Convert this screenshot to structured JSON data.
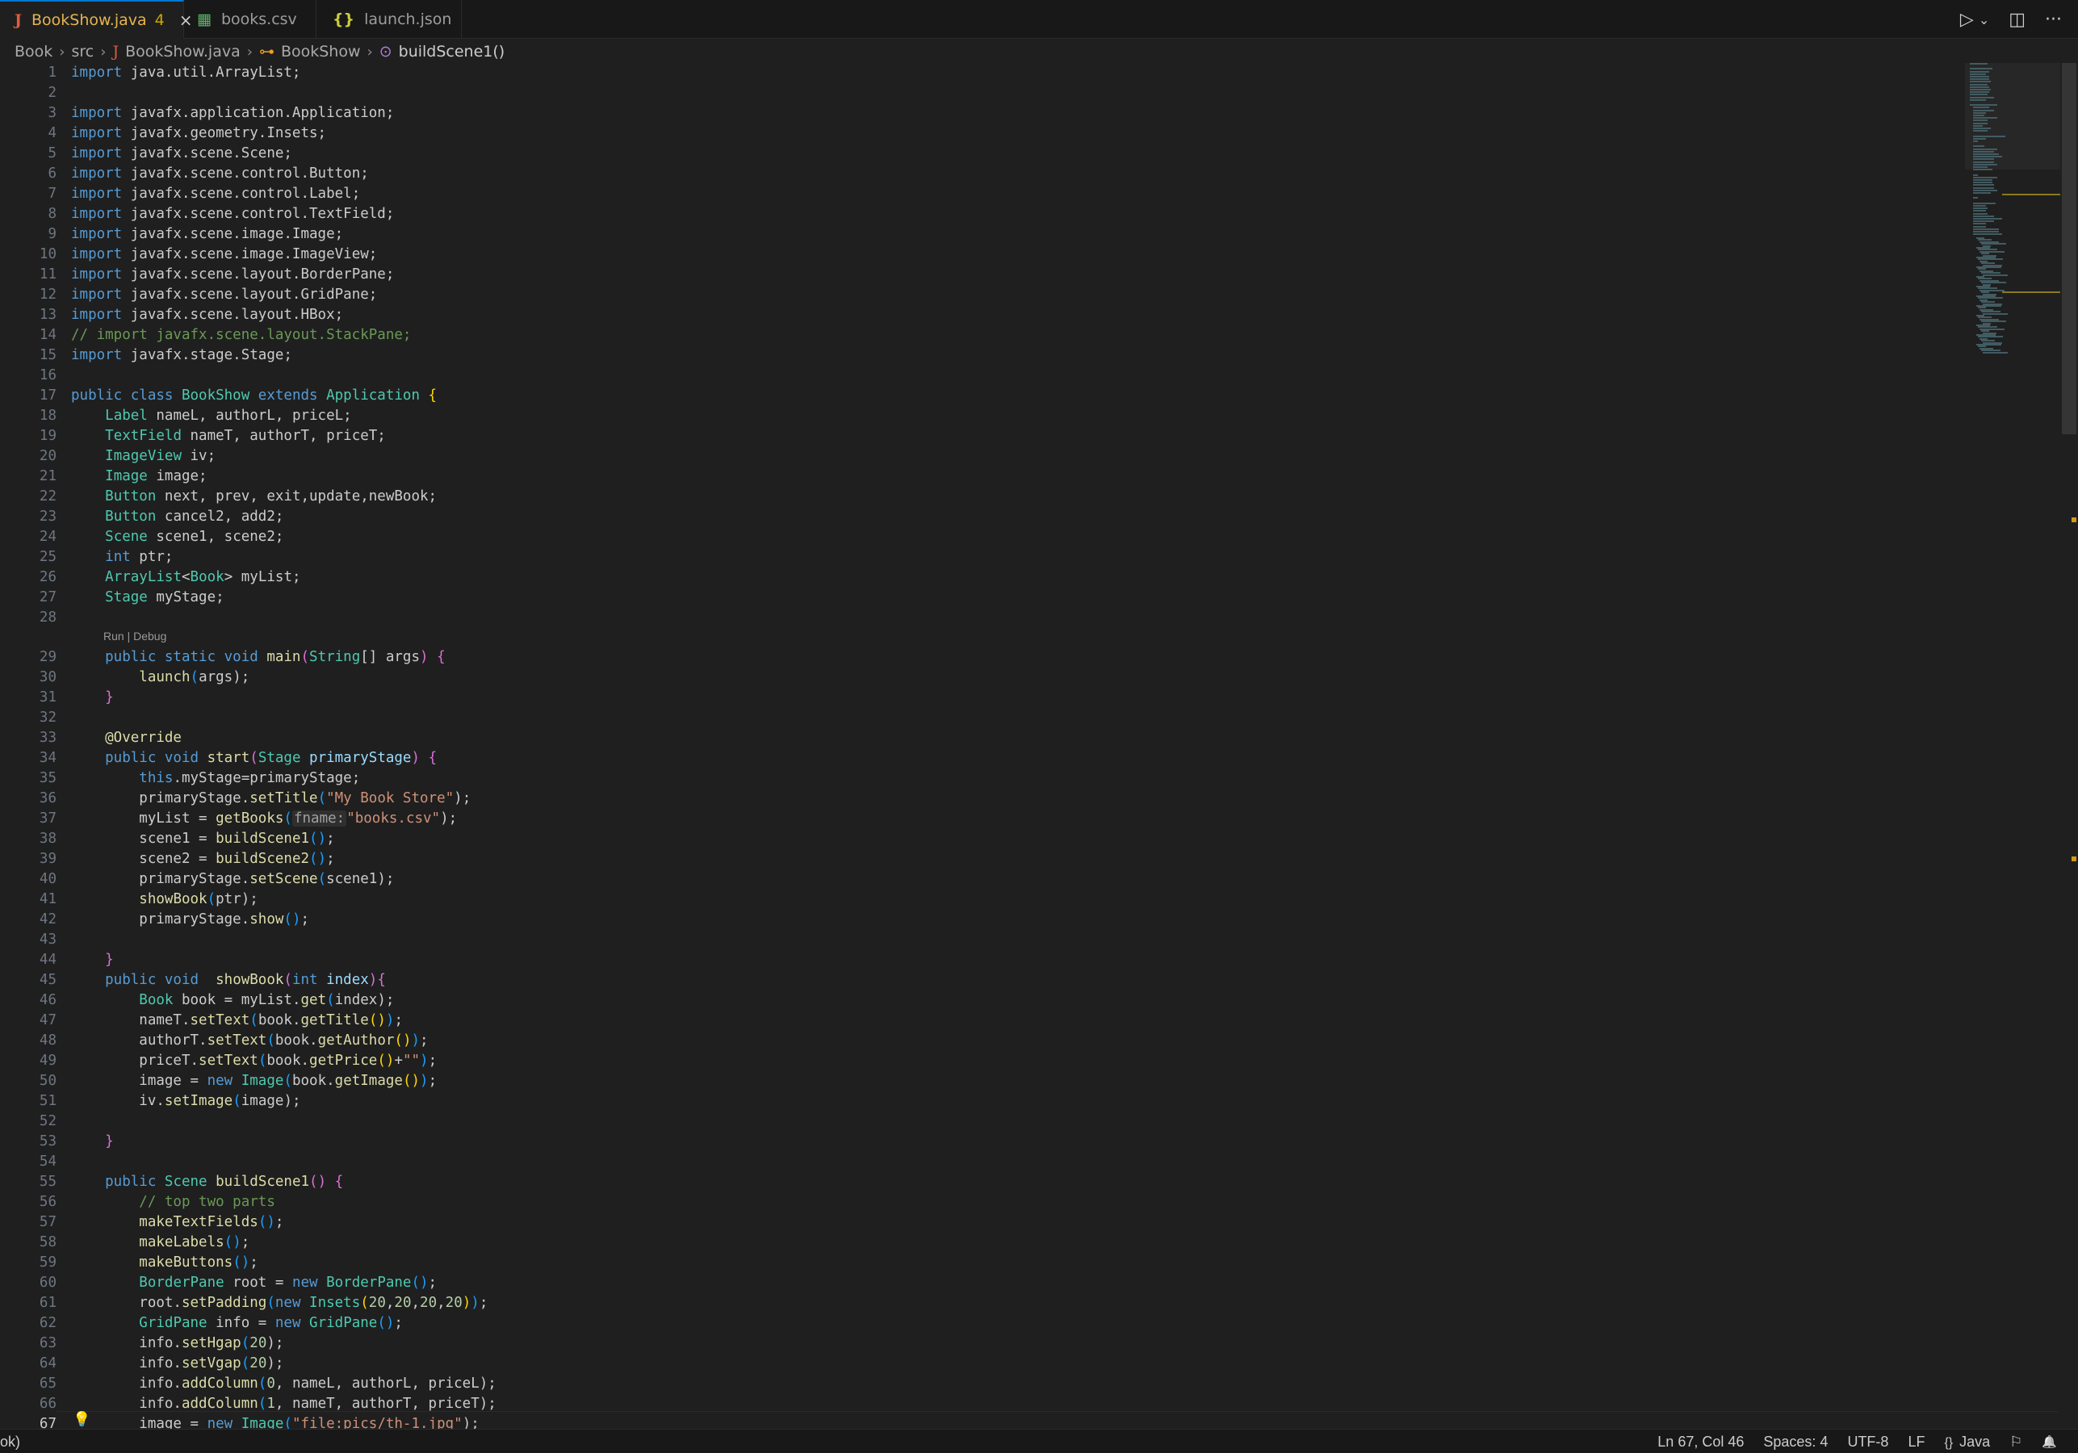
{
  "tabs": [
    {
      "icon": "J",
      "label": "BookShow.java",
      "badge": "4",
      "close": "×"
    },
    {
      "icon": "▦",
      "label": "books.csv"
    },
    {
      "icon": "{}",
      "label": "launch.json"
    }
  ],
  "actions": {
    "run": "▷",
    "run_menu": "⌄",
    "split": "◫",
    "more": "···"
  },
  "breadcrumb": {
    "project": "Book",
    "folder": "src",
    "file_icon": "J",
    "file": "BookShow.java",
    "class_icon": "⊶",
    "class": "BookShow",
    "method_icon": "⊙",
    "method": "buildScene1()"
  },
  "codelens": "Run | Debug",
  "line_numbers": [
    "1",
    "2",
    "3",
    "4",
    "5",
    "6",
    "7",
    "8",
    "9",
    "10",
    "11",
    "12",
    "13",
    "14",
    "15",
    "16",
    "17",
    "18",
    "19",
    "20",
    "21",
    "22",
    "23",
    "24",
    "25",
    "26",
    "27",
    "28",
    "29",
    "30",
    "31",
    "32",
    "33",
    "34",
    "35",
    "36",
    "37",
    "38",
    "39",
    "40",
    "41",
    "42",
    "43",
    "44",
    "45",
    "46",
    "47",
    "48",
    "49",
    "50",
    "51",
    "52",
    "53",
    "54",
    "55",
    "56",
    "57",
    "58",
    "59",
    "60",
    "61",
    "62",
    "63",
    "64",
    "65",
    "66",
    "67"
  ],
  "code": {
    "l1": [
      "import",
      " java.util.ArrayList;"
    ],
    "l3": [
      "import",
      " javafx.application.Application;"
    ],
    "l4": [
      "import",
      " javafx.geometry.Insets;"
    ],
    "l5": [
      "import",
      " javafx.scene.Scene;"
    ],
    "l6": [
      "import",
      " javafx.scene.control.Button;"
    ],
    "l7": [
      "import",
      " javafx.scene.control.Label;"
    ],
    "l8": [
      "import",
      " javafx.scene.control.TextField;"
    ],
    "l9": [
      "import",
      " javafx.scene.image.Image;"
    ],
    "l10": [
      "import",
      " javafx.scene.image.ImageView;"
    ],
    "l11": [
      "import",
      " javafx.scene.layout.BorderPane;"
    ],
    "l12": [
      "import",
      " javafx.scene.layout.GridPane;"
    ],
    "l13": [
      "import",
      " javafx.scene.layout.HBox;"
    ],
    "l14": "// import javafx.scene.layout.StackPane;",
    "l15": [
      "import",
      " javafx.stage.Stage;"
    ],
    "l17": [
      "public class ",
      "BookShow",
      " extends ",
      "Application",
      " ",
      "{"
    ],
    "l18": [
      "    ",
      "Label",
      " nameL, authorL, priceL;"
    ],
    "l19": [
      "    ",
      "TextField",
      " nameT, authorT, priceT;"
    ],
    "l20": [
      "    ",
      "ImageView",
      " iv;"
    ],
    "l21": [
      "    ",
      "Image",
      " image;"
    ],
    "l22": [
      "    ",
      "Button",
      " next, prev, exit,update,newBook;"
    ],
    "l23": [
      "    ",
      "Button",
      " cancel2, add2;"
    ],
    "l24": [
      "    ",
      "Scene",
      " scene1, scene2;"
    ],
    "l25": [
      "    ",
      "int",
      " ptr;"
    ],
    "l26": [
      "    ",
      "ArrayList",
      "<",
      "Book",
      "> myList;"
    ],
    "l27": [
      "    ",
      "Stage",
      " myStage;"
    ],
    "l29": [
      "    public static void ",
      "main",
      "(",
      "String",
      "[] args",
      ")",
      " ",
      "{"
    ],
    "l30": [
      "        ",
      "launch",
      "(",
      "args",
      ");"
    ],
    "l31": [
      "    ",
      "}"
    ],
    "l33": "    @Override",
    "l34": [
      "    public void ",
      "start",
      "(",
      "Stage",
      " primaryStage",
      ")",
      " ",
      "{"
    ],
    "l35": [
      "        this",
      ".myStage=primaryStage;"
    ],
    "l36": [
      "        primaryStage.",
      "setTitle",
      "(",
      "\"My Book Store\"",
      ");"
    ],
    "l37": [
      "        myList = ",
      "getBooks",
      "(",
      "fname:",
      "\"books.csv\"",
      ");"
    ],
    "l38": [
      "        scene1 = ",
      "buildScene1",
      "()",
      ";"
    ],
    "l39": [
      "        scene2 = ",
      "buildScene2",
      "()",
      ";"
    ],
    "l40": [
      "        primaryStage.",
      "setScene",
      "(",
      "scene1",
      ");"
    ],
    "l41": [
      "        ",
      "showBook",
      "(",
      "ptr",
      ");"
    ],
    "l42": [
      "        primaryStage.",
      "show",
      "()",
      ";"
    ],
    "l44": [
      "    ",
      "}"
    ],
    "l45": [
      "    public void  ",
      "showBook",
      "(",
      "int",
      " index",
      ")",
      "{"
    ],
    "l46": [
      "        ",
      "Book",
      " book = myList.",
      "get",
      "(",
      "index",
      ");"
    ],
    "l47": [
      "        nameT.",
      "setText",
      "(",
      "book.",
      "getTitle",
      "()",
      ")",
      ";"
    ],
    "l48": [
      "        authorT.",
      "setText",
      "(",
      "book.",
      "getAuthor",
      "()",
      ")",
      ";"
    ],
    "l49": [
      "        priceT.",
      "setText",
      "(",
      "book.",
      "getPrice",
      "()",
      "+",
      "\"\"",
      ")",
      ";"
    ],
    "l50": [
      "        image = ",
      "new ",
      "Image",
      "(",
      "book.",
      "getImage",
      "()",
      ")",
      ";"
    ],
    "l51": [
      "        iv.",
      "setImage",
      "(",
      "image",
      ");"
    ],
    "l53": [
      "    ",
      "}"
    ],
    "l55": [
      "    public ",
      "Scene",
      " ",
      "buildScene1",
      "()",
      " ",
      "{"
    ],
    "l56": "        // top two parts",
    "l57": [
      "        ",
      "makeTextFields",
      "()",
      ";"
    ],
    "l58": [
      "        ",
      "makeLabels",
      "()",
      ";"
    ],
    "l59": [
      "        ",
      "makeButtons",
      "()",
      ";"
    ],
    "l60": [
      "        ",
      "BorderPane",
      " root = ",
      "new ",
      "BorderPane",
      "()",
      ";"
    ],
    "l61": [
      "        root.",
      "setPadding",
      "(",
      "new ",
      "Insets",
      "(",
      "20",
      ",",
      "20",
      ",",
      "20",
      ",",
      "20",
      ")",
      ")",
      ";"
    ],
    "l62": [
      "        ",
      "GridPane",
      " info = ",
      "new ",
      "GridPane",
      "()",
      ";"
    ],
    "l63": [
      "        info.",
      "setHgap",
      "(",
      "20",
      ");"
    ],
    "l64": [
      "        info.",
      "setVgap",
      "(",
      "20",
      ");"
    ],
    "l65": [
      "        info.",
      "addColumn",
      "(",
      "0",
      ", nameL, authorL, priceL",
      ");"
    ],
    "l66": [
      "        info.",
      "addColumn",
      "(",
      "1",
      ", nameT, authorT, priceT",
      ");"
    ],
    "l67": [
      "        image = ",
      "new ",
      "Image",
      "(",
      "\"file:pics/th-1.jpg\"",
      ");"
    ]
  },
  "statusbar": {
    "left": "ok)",
    "position": "Ln 67, Col 46",
    "spaces": "Spaces: 4",
    "encoding": "UTF-8",
    "eol": "LF",
    "lang_icon": "{}",
    "language": "Java",
    "feedback_icon": "⚐",
    "bell_icon": "🔔"
  },
  "lightbulb": "💡"
}
